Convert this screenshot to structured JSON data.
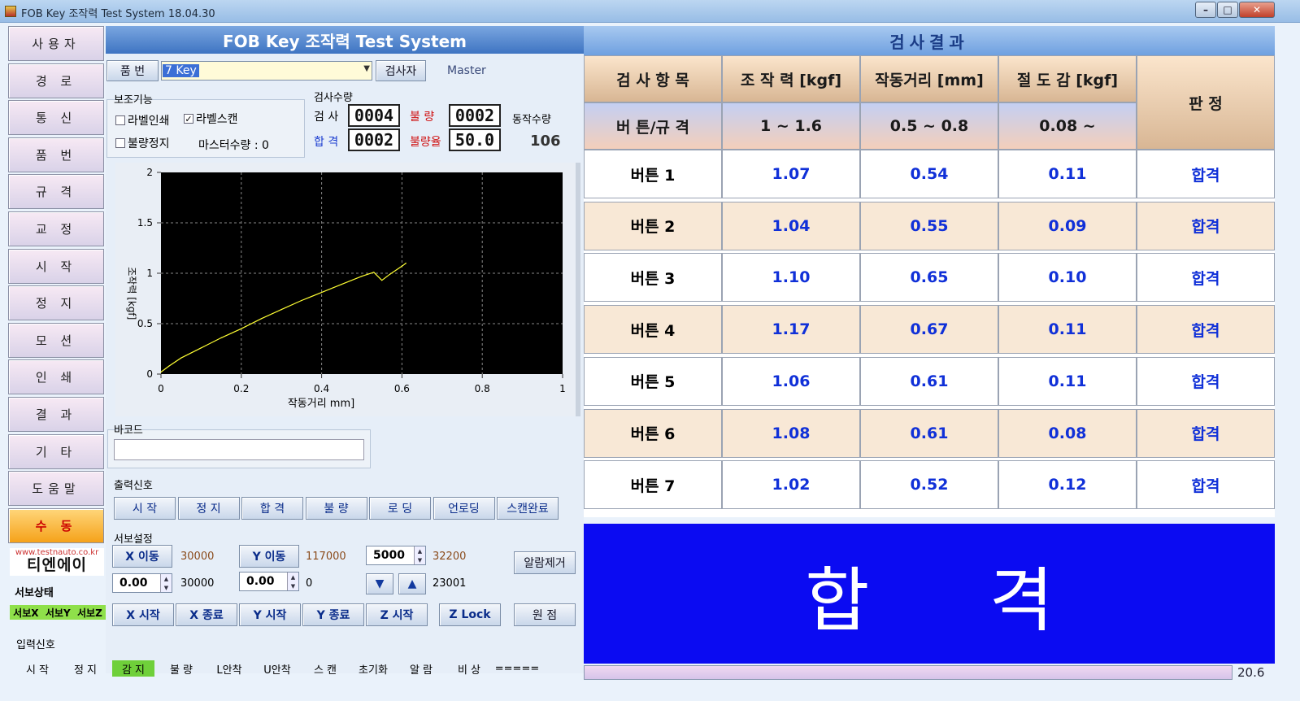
{
  "window": {
    "title": "FOB Key 조작력 Test System 18.04.30"
  },
  "sidebar": {
    "items": [
      "사용자",
      "경 로",
      "통 신",
      "품 번",
      "규 격",
      "교 정",
      "시 작",
      "정 지",
      "모 션",
      "인 쇄",
      "결 과",
      "기 타",
      "도움말",
      "수 동"
    ],
    "active": "수 동"
  },
  "logo": {
    "url": "www.testnauto.co.kr",
    "name": "티엔에이"
  },
  "servo_status": {
    "label": "서보상태",
    "items": [
      "서보X",
      "서보Y",
      "서보Z"
    ]
  },
  "header": {
    "title": "FOB Key 조작력 Test System"
  },
  "part": {
    "label": "품 번",
    "value": "7 Key",
    "inspector_button": "검사자",
    "inspector": "Master"
  },
  "aux": {
    "title": "보조기능",
    "label_print": "라벨인쇄",
    "label_scan": "라벨스캔",
    "defect_stop": "불량정지",
    "master_count_label": "마스터수량 : 0"
  },
  "counts": {
    "title": "검사수량",
    "inspect_label": "검 사",
    "inspect": "0004",
    "defect_label": "불 량",
    "defect": "0002",
    "pass_label": "합 격",
    "pass": "0002",
    "defect_rate_label": "불량율",
    "defect_rate": "50.0",
    "ops_label": "동작수량",
    "ops": "106"
  },
  "chart_data": {
    "type": "line",
    "xlabel": "작동거리 mm]",
    "ylabel": "조작력 [kgf]",
    "xlim": [
      0,
      1
    ],
    "ylim": [
      0,
      2
    ],
    "xticks": [
      "0",
      "0.2",
      "0.4",
      "0.6",
      "0.8",
      "1"
    ],
    "yticks": [
      "0",
      "0.5",
      "1",
      "1.5",
      "2"
    ],
    "x": [
      0,
      0.02,
      0.05,
      0.1,
      0.15,
      0.2,
      0.25,
      0.3,
      0.35,
      0.4,
      0.45,
      0.5,
      0.53,
      0.55,
      0.57,
      0.6,
      0.61
    ],
    "y": [
      0.02,
      0.08,
      0.16,
      0.26,
      0.36,
      0.45,
      0.55,
      0.64,
      0.73,
      0.81,
      0.89,
      0.97,
      1.01,
      0.93,
      0.99,
      1.07,
      1.1
    ],
    "grid": true,
    "background": "#000000",
    "line_color": "#ffff33"
  },
  "barcode": {
    "label": "바코드",
    "value": ""
  },
  "output_signals": {
    "title": "출력신호",
    "buttons": [
      "시 작",
      "정 지",
      "합 격",
      "불 량",
      "로 딩",
      "언로딩",
      "스캔완료"
    ]
  },
  "servo": {
    "title": "서보설정",
    "x_move": "X 이동",
    "x_move_val": "30000",
    "y_move": "Y 이동",
    "y_move_val": "117000",
    "z_spin": "5000",
    "z_val": "32200",
    "alarm_clear": "알람제거",
    "x_spin": "0.00",
    "x_val": "30000",
    "y_spin": "0.00",
    "y_val": "0",
    "zpos_val": "23001",
    "buttons": [
      "X 시작",
      "X 종료",
      "Y 시작",
      "Y 종료",
      "Z 시작"
    ],
    "z_lock": "Z Lock",
    "origin": "원 점"
  },
  "input_signals": {
    "title": "입력신호",
    "items": [
      "시 작",
      "정 지",
      "감 지",
      "불 량",
      "L안착",
      "U안착",
      "스 캔",
      "초기화",
      "알 람",
      "비 상",
      "====="
    ],
    "active": "감 지"
  },
  "results": {
    "title": "검사결과",
    "headers": [
      "검 사 항 목",
      "조 작 력 [kgf]",
      "작동거리 [mm]",
      "절 도 감 [kgf]",
      "판 정"
    ],
    "spec_row": [
      "버 튼/규 격",
      "1 ~ 1.6",
      "0.5 ~ 0.8",
      "0.08 ~"
    ],
    "rows": [
      {
        "name": "버튼 1",
        "force": "1.07",
        "dist": "0.54",
        "click": "0.11",
        "judge": "합격"
      },
      {
        "name": "버튼 2",
        "force": "1.04",
        "dist": "0.55",
        "click": "0.09",
        "judge": "합격"
      },
      {
        "name": "버튼 3",
        "force": "1.10",
        "dist": "0.65",
        "click": "0.10",
        "judge": "합격"
      },
      {
        "name": "버튼 4",
        "force": "1.17",
        "dist": "0.67",
        "click": "0.11",
        "judge": "합격"
      },
      {
        "name": "버튼 5",
        "force": "1.06",
        "dist": "0.61",
        "click": "0.11",
        "judge": "합격"
      },
      {
        "name": "버튼 6",
        "force": "1.08",
        "dist": "0.61",
        "click": "0.08",
        "judge": "합격"
      },
      {
        "name": "버튼 7",
        "force": "1.02",
        "dist": "0.52",
        "click": "0.12",
        "judge": "합격"
      }
    ]
  },
  "final": {
    "verdict": "합 격"
  },
  "footer": {
    "time": "20.6"
  },
  "colors": {
    "pass_bg": "#0b0bf2",
    "value_blue": "#1030d8",
    "active_orange": "#f5a21a"
  }
}
